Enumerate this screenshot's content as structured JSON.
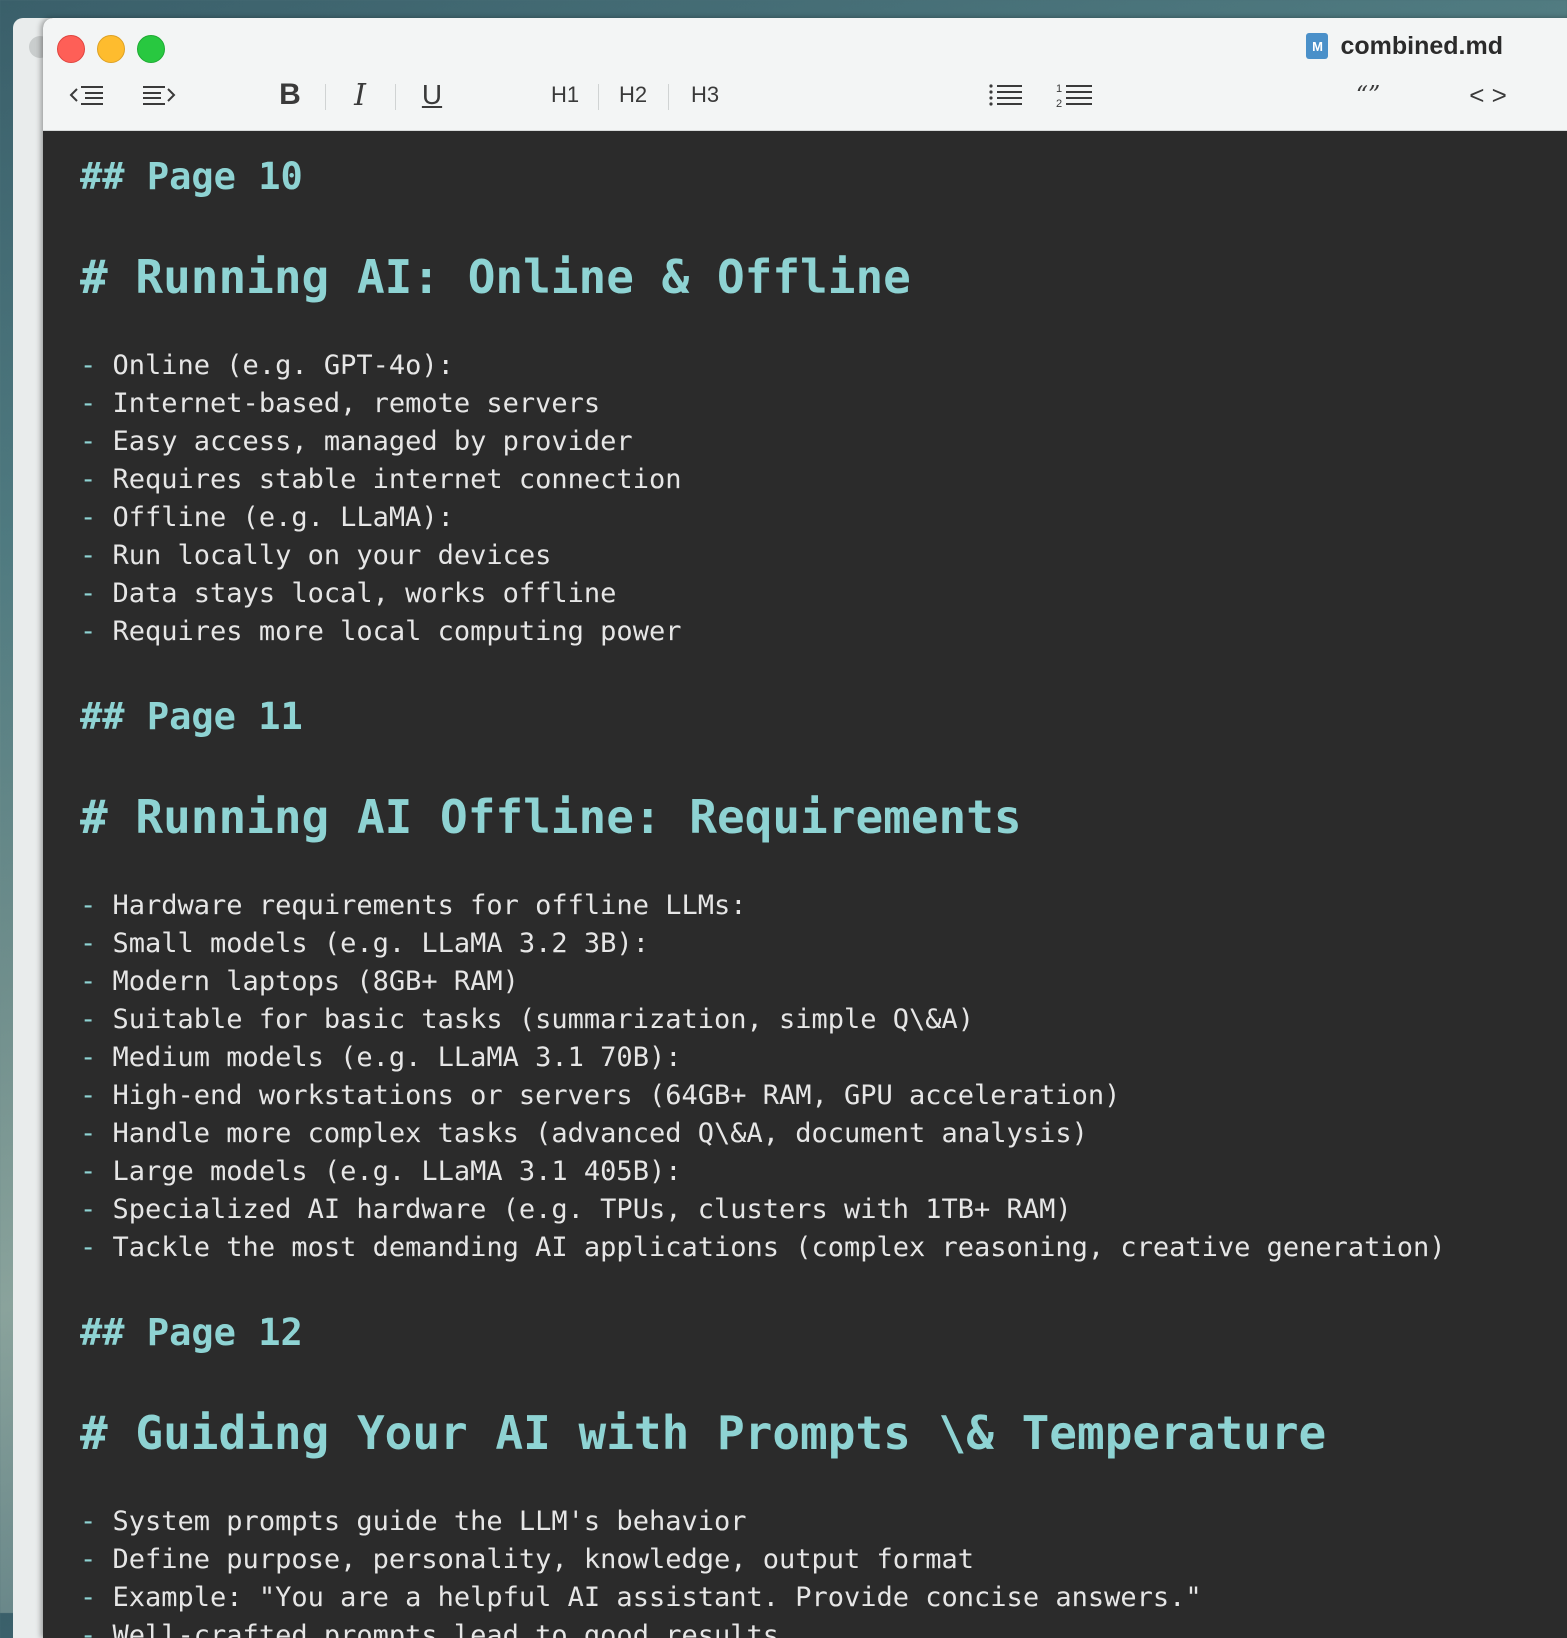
{
  "window": {
    "file_badge": "M",
    "file_name": "combined.md"
  },
  "toolbar": {
    "outdent_icon": "outdent-icon",
    "indent_icon": "indent-icon",
    "bold": "B",
    "italic": "I",
    "underline": "U",
    "h1": "H1",
    "h2": "H2",
    "h3": "H3",
    "bullet_list_icon": "bullet-list-icon",
    "numbered_list_icon": "numbered-list-icon",
    "quote": "“”",
    "code": "< >"
  },
  "document": {
    "page10_heading": "## Page 10",
    "page10_title": "# Running AI: Online & Offline",
    "page10_items": [
      "Online (e.g. GPT-4o):",
      "Internet-based, remote servers",
      "Easy access, managed by provider",
      "Requires stable internet connection",
      "Offline (e.g. LLaMA):",
      "Run locally on your devices",
      "Data stays local, works offline",
      "Requires more local computing power"
    ],
    "page11_heading": "## Page 11",
    "page11_title": "# Running AI Offline: Requirements",
    "page11_items": [
      "Hardware requirements for offline LLMs:",
      "Small models (e.g. LLaMA 3.2 3B):",
      "Modern laptops (8GB+ RAM)",
      "Suitable for basic tasks (summarization, simple Q\\&A)",
      "Medium models (e.g. LLaMA 3.1 70B):",
      "High-end workstations or servers (64GB+ RAM, GPU acceleration)",
      "Handle more complex tasks (advanced Q\\&A, document analysis)",
      "Large models (e.g. LLaMA 3.1 405B):",
      "Specialized AI hardware (e.g. TPUs, clusters with 1TB+ RAM)",
      "Tackle the most demanding AI applications (complex reasoning, creative generation)"
    ],
    "page12_heading": "## Page 12",
    "page12_title": "# Guiding Your AI with Prompts \\& Temperature",
    "page12_items": [
      "System prompts guide the LLM's behavior",
      "Define purpose, personality, knowledge, output format",
      "Example: \"You are a helpful AI assistant. Provide concise answers.\"",
      "Well-crafted prompts lead to good results"
    ],
    "bullet": "- "
  }
}
